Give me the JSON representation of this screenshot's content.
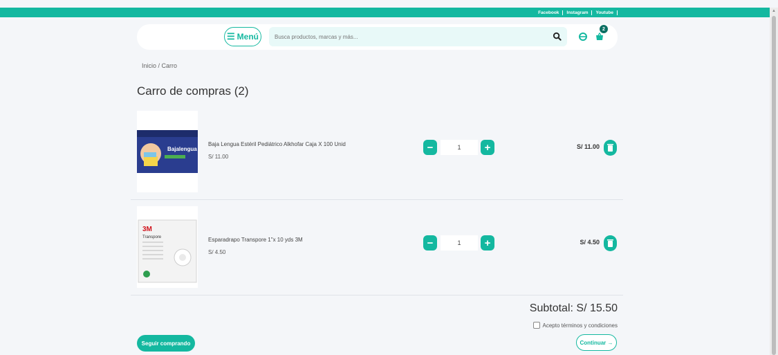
{
  "social_links": [
    "Facebook",
    "Instagram",
    "Youtube"
  ],
  "header": {
    "menu_label": "Menú",
    "search_placeholder": "Busca productos, marcas y más...",
    "cart_count": "2"
  },
  "breadcrumb": "Inicio / Carro",
  "page_title": "Carro de compras (2)",
  "items": [
    {
      "name": "Baja Lengua Estéril Pediátrico Alkhofar Caja X 100 Unid",
      "price": "S/ 11.00",
      "qty": "1",
      "total": "S/ 11.00"
    },
    {
      "name": "Esparadrapo Transpore 1\"x 10 yds 3M",
      "price": "S/ 4.50",
      "qty": "1",
      "total": "S/ 4.50"
    }
  ],
  "subtotal": "Subtotal: S/ 15.50",
  "terms_label": "Acepto términos y condiciones",
  "continue_shopping_label": "Seguir comprando",
  "continue_label": "Continuar →",
  "product_image_text": {
    "item1": "Bajalengua",
    "item2_brand": "3M",
    "item2_product": "Transpore"
  },
  "colors": {
    "accent": "#14b8a0",
    "badge": "#0c6f63",
    "background": "#f4f6f9"
  }
}
